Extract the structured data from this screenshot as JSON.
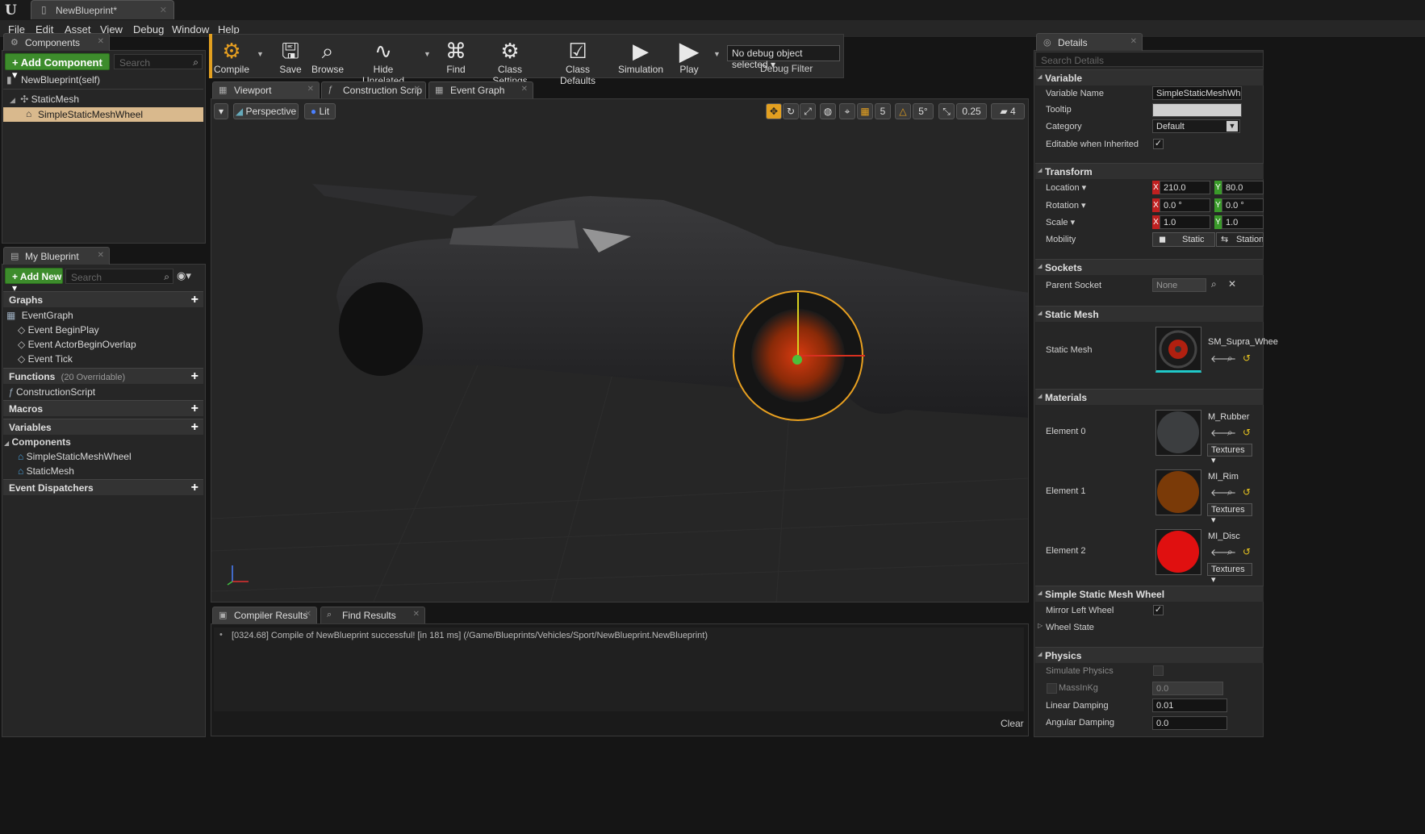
{
  "window": {
    "tab_title": "NewBlueprint*"
  },
  "menu": [
    "File",
    "Edit",
    "Asset",
    "View",
    "Debug",
    "Window",
    "Help"
  ],
  "components_panel": {
    "tab": "Components",
    "add_button": "+ Add Component ▾",
    "search_placeholder": "Search",
    "self_label": "NewBlueprint(self)",
    "tree": [
      {
        "label": "StaticMesh"
      },
      {
        "label": "SimpleStaticMeshWheel",
        "selected": true
      }
    ]
  },
  "my_blueprint": {
    "tab": "My Blueprint",
    "add_new": "+ Add New ▾",
    "search_placeholder": "Search",
    "graphs_header": "Graphs",
    "graphs": [
      "EventGraph",
      "Event BeginPlay",
      "Event ActorBeginOverlap",
      "Event Tick"
    ],
    "functions_header": "Functions",
    "functions_override": "(20 Overridable)",
    "functions": [
      "ConstructionScript"
    ],
    "macros_header": "Macros",
    "variables_header": "Variables",
    "components_sub": "Components",
    "component_vars": [
      "SimpleStaticMeshWheel",
      "StaticMesh"
    ],
    "dispatchers_header": "Event Dispatchers"
  },
  "toolbar": {
    "buttons": [
      "Compile",
      "Save",
      "Browse",
      "Hide Unrelated",
      "Find",
      "Class Settings",
      "Class Defaults",
      "Simulation",
      "Play"
    ],
    "debug_select": "No debug object selected ▾",
    "debug_filter": "Debug Filter"
  },
  "editor_tabs": [
    "Viewport",
    "Construction Scrip",
    "Event Graph"
  ],
  "viewport": {
    "perspective": "Perspective",
    "lit": "Lit",
    "grid_snap": "5",
    "rot_snap": "5°",
    "scale_snap": "0.25",
    "cam_speed": "4"
  },
  "bottom_tabs": [
    "Compiler Results",
    "Find Results"
  ],
  "compiler": {
    "message": "[0324.68] Compile of NewBlueprint successful! [in 181 ms] (/Game/Blueprints/Vehicles/Sport/NewBlueprint.NewBlueprint)",
    "clear": "Clear"
  },
  "details": {
    "tab": "Details",
    "search_placeholder": "Search Details",
    "variable": {
      "header": "Variable",
      "name_label": "Variable Name",
      "name_value": "SimpleStaticMeshWhee",
      "tooltip_label": "Tooltip",
      "category_label": "Category",
      "category_value": "Default",
      "editable_label": "Editable when Inherited"
    },
    "transform": {
      "header": "Transform",
      "location": "Location ▾",
      "rotation": "Rotation ▾",
      "scale": "Scale ▾",
      "mobility": "Mobility",
      "loc_x": "210.0",
      "loc_y": "80.0",
      "rot_x": "0.0 °",
      "rot_y": "0.0 °",
      "scale_x": "1.0",
      "scale_y": "1.0",
      "static": "Static",
      "stationary": "Stationa"
    },
    "sockets": {
      "header": "Sockets",
      "parent_label": "Parent Socket",
      "parent_value": "None"
    },
    "static_mesh": {
      "header": "Static Mesh",
      "label": "Static Mesh",
      "asset": "SM_Supra_Whee"
    },
    "materials": {
      "header": "Materials",
      "elements": [
        {
          "label": "Element 0",
          "asset": "M_Rubber",
          "textures": "Textures ▾",
          "color": "#3a3c3e"
        },
        {
          "label": "Element 1",
          "asset": "MI_Rim",
          "textures": "Textures ▾",
          "color": "#7a3a08"
        },
        {
          "label": "Element 2",
          "asset": "MI_Disc",
          "textures": "Textures ▾",
          "color": "#e01010"
        }
      ]
    },
    "wheel": {
      "header": "Simple Static Mesh Wheel",
      "mirror_label": "Mirror Left Wheel",
      "state_label": "Wheel State"
    },
    "physics": {
      "header": "Physics",
      "simulate": "Simulate Physics",
      "mass": "MassInKg",
      "mass_value": "0.0",
      "linear": "Linear Damping",
      "linear_value": "0.01",
      "angular": "Angular Damping",
      "angular_value": "0.0"
    }
  }
}
